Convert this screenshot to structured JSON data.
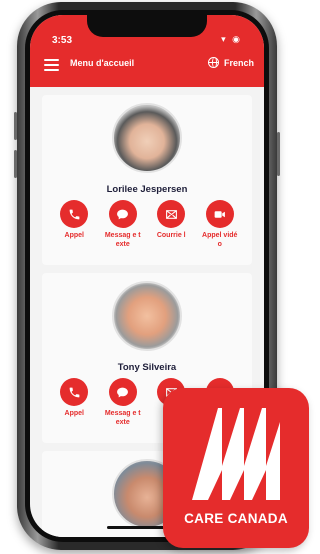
{
  "status": {
    "time": "3:53",
    "icons": "▾ ◉"
  },
  "header": {
    "menu_title": "Menu d'accueil",
    "language": "French"
  },
  "contacts": [
    {
      "name": "Lorilee Jespersen",
      "actions": [
        {
          "label": "Appel",
          "icon": "phone-icon"
        },
        {
          "label": "Messag e texte",
          "icon": "chat-icon"
        },
        {
          "label": "Courrie l",
          "icon": "mail-icon"
        },
        {
          "label": "Appel vidéo",
          "icon": "video-icon"
        }
      ]
    },
    {
      "name": "Tony Silveira",
      "actions": [
        {
          "label": "Appel",
          "icon": "phone-icon"
        },
        {
          "label": "Messag e texte",
          "icon": "chat-icon"
        },
        {
          "label": "",
          "icon": "mail-icon"
        },
        {
          "label": "",
          "icon": "video-icon"
        }
      ]
    },
    {
      "name": ""
    }
  ],
  "badge": {
    "text": "CARE CANADA"
  },
  "colors": {
    "accent": "#e52c2c",
    "name_text": "#1f1f3a",
    "background": "#f3f3f3"
  }
}
